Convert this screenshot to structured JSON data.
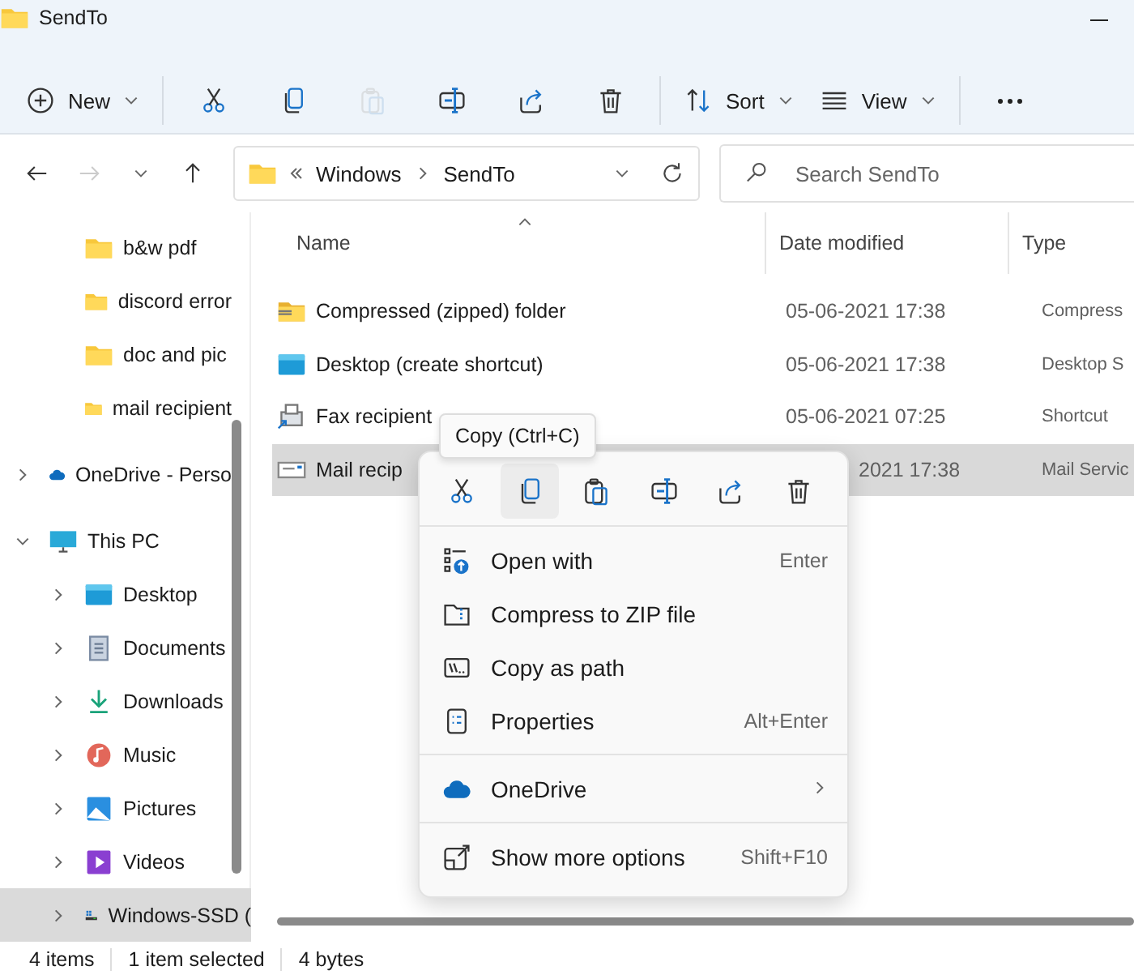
{
  "window": {
    "title": "SendTo"
  },
  "toolbar": [
    {
      "kind": "new",
      "label": "New",
      "disabled": false
    },
    {
      "kind": "cut",
      "disabled": false
    },
    {
      "kind": "copy",
      "disabled": false
    },
    {
      "kind": "paste",
      "disabled": true
    },
    {
      "kind": "rename",
      "disabled": false
    },
    {
      "kind": "share",
      "disabled": false
    },
    {
      "kind": "delete",
      "disabled": false
    },
    {
      "kind": "sort",
      "label": "Sort",
      "disabled": false
    },
    {
      "kind": "view",
      "label": "View",
      "disabled": false
    },
    {
      "kind": "more",
      "disabled": false
    }
  ],
  "navigation": {
    "back_disabled": false,
    "forward_disabled": true
  },
  "address": {
    "path": [
      "Windows",
      "SendTo"
    ]
  },
  "search": {
    "placeholder": "Search SendTo"
  },
  "sidebar": {
    "items": [
      {
        "label": "b&w pdf",
        "kind": "folder",
        "selected": false
      },
      {
        "label": "discord error",
        "kind": "folder",
        "selected": false
      },
      {
        "label": "doc and pic",
        "kind": "folder",
        "selected": false
      },
      {
        "label": "mail recipient",
        "kind": "folder",
        "selected": false
      },
      {
        "label": "OneDrive - Perso",
        "kind": "cloud",
        "expanded": false,
        "selected": false
      },
      {
        "label": "This PC",
        "kind": "pc",
        "expanded": true,
        "selected": false,
        "children": [
          {
            "label": "Desktop",
            "kind": "desktop",
            "expanded": false,
            "selected": false
          },
          {
            "label": "Documents",
            "kind": "documents",
            "expanded": false,
            "selected": false
          },
          {
            "label": "Downloads",
            "kind": "downloads",
            "expanded": false,
            "selected": false
          },
          {
            "label": "Music",
            "kind": "music",
            "expanded": false,
            "selected": false
          },
          {
            "label": "Pictures",
            "kind": "pictures",
            "expanded": false,
            "selected": false
          },
          {
            "label": "Videos",
            "kind": "videos",
            "expanded": false,
            "selected": false
          },
          {
            "label": "Windows-SSD (",
            "kind": "drive",
            "expanded": false,
            "selected": true
          }
        ]
      }
    ]
  },
  "table": {
    "columns": [
      "Name",
      "Date modified",
      "Type"
    ],
    "rows": [
      {
        "kind": "zip",
        "name": "Compressed (zipped) folder",
        "date": "05-06-2021 17:38",
        "type": "Compress",
        "selected": false,
        "covered": false
      },
      {
        "kind": "desktop",
        "name": "Desktop (create shortcut)",
        "date": "05-06-2021 17:38",
        "type": "Desktop S",
        "selected": false,
        "covered": false
      },
      {
        "kind": "fax",
        "name": "Fax recipient",
        "date": "05-06-2021 07:25",
        "type": "Shortcut",
        "selected": false,
        "covered": false
      },
      {
        "kind": "mail",
        "name": "Mail recip",
        "date": "2021 17:38",
        "type": "Mail Servic",
        "selected": true,
        "covered": true
      }
    ]
  },
  "tooltip": {
    "text": "Copy (Ctrl+C)"
  },
  "context_menu": {
    "actions": [
      {
        "kind": "cut",
        "selected": false
      },
      {
        "kind": "copy",
        "selected": true
      },
      {
        "kind": "paste",
        "selected": false
      },
      {
        "kind": "rename",
        "selected": false
      },
      {
        "kind": "share",
        "selected": false
      },
      {
        "kind": "delete",
        "selected": false
      }
    ],
    "groups": [
      [
        {
          "kind": "openwith",
          "label": "Open with",
          "shortcut": "Enter"
        },
        {
          "kind": "zipfolder",
          "label": "Compress to ZIP file"
        },
        {
          "kind": "path",
          "label": "Copy as path"
        },
        {
          "kind": "properties",
          "label": "Properties",
          "shortcut": "Alt+Enter"
        }
      ],
      [
        {
          "kind": "cloud",
          "label": "OneDrive",
          "submenu": true
        }
      ],
      [
        {
          "kind": "more",
          "label": "Show more options",
          "shortcut": "Shift+F10"
        }
      ]
    ]
  },
  "status_bar": {
    "items": [
      "4 items",
      "1 item selected",
      "4 bytes"
    ]
  }
}
